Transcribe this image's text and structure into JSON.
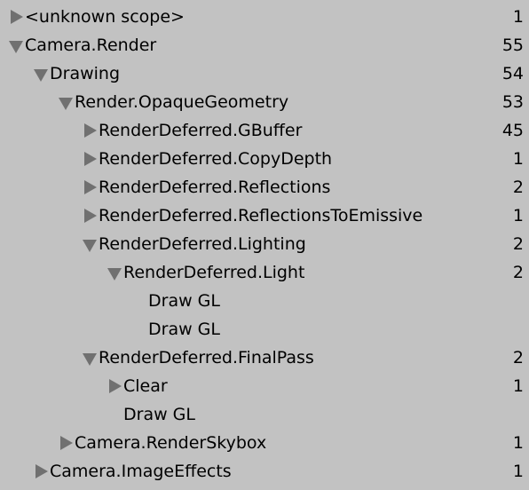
{
  "rows": [
    {
      "label": "<unknown scope>",
      "count": "1",
      "arrow": "right"
    },
    {
      "label": "Camera.Render",
      "count": "55",
      "arrow": "down"
    },
    {
      "label": "Drawing",
      "count": "54",
      "arrow": "down"
    },
    {
      "label": "Render.OpaqueGeometry",
      "count": "53",
      "arrow": "down"
    },
    {
      "label": "RenderDeferred.GBuffer",
      "count": "45",
      "arrow": "right"
    },
    {
      "label": "RenderDeferred.CopyDepth",
      "count": "1",
      "arrow": "right"
    },
    {
      "label": "RenderDeferred.Reflections",
      "count": "2",
      "arrow": "right"
    },
    {
      "label": "RenderDeferred.ReflectionsToEmissive",
      "count": "1",
      "arrow": "right"
    },
    {
      "label": "RenderDeferred.Lighting",
      "count": "2",
      "arrow": "down"
    },
    {
      "label": "RenderDeferred.Light",
      "count": "2",
      "arrow": "down"
    },
    {
      "label": "Draw GL",
      "count": "",
      "arrow": "none"
    },
    {
      "label": "Draw GL",
      "count": "",
      "arrow": "none"
    },
    {
      "label": "RenderDeferred.FinalPass",
      "count": "2",
      "arrow": "down"
    },
    {
      "label": "Clear",
      "count": "1",
      "arrow": "right"
    },
    {
      "label": "Draw GL",
      "count": "",
      "arrow": "none"
    },
    {
      "label": "Camera.RenderSkybox",
      "count": "1",
      "arrow": "right"
    },
    {
      "label": "Camera.ImageEffects",
      "count": "1",
      "arrow": "right"
    }
  ]
}
